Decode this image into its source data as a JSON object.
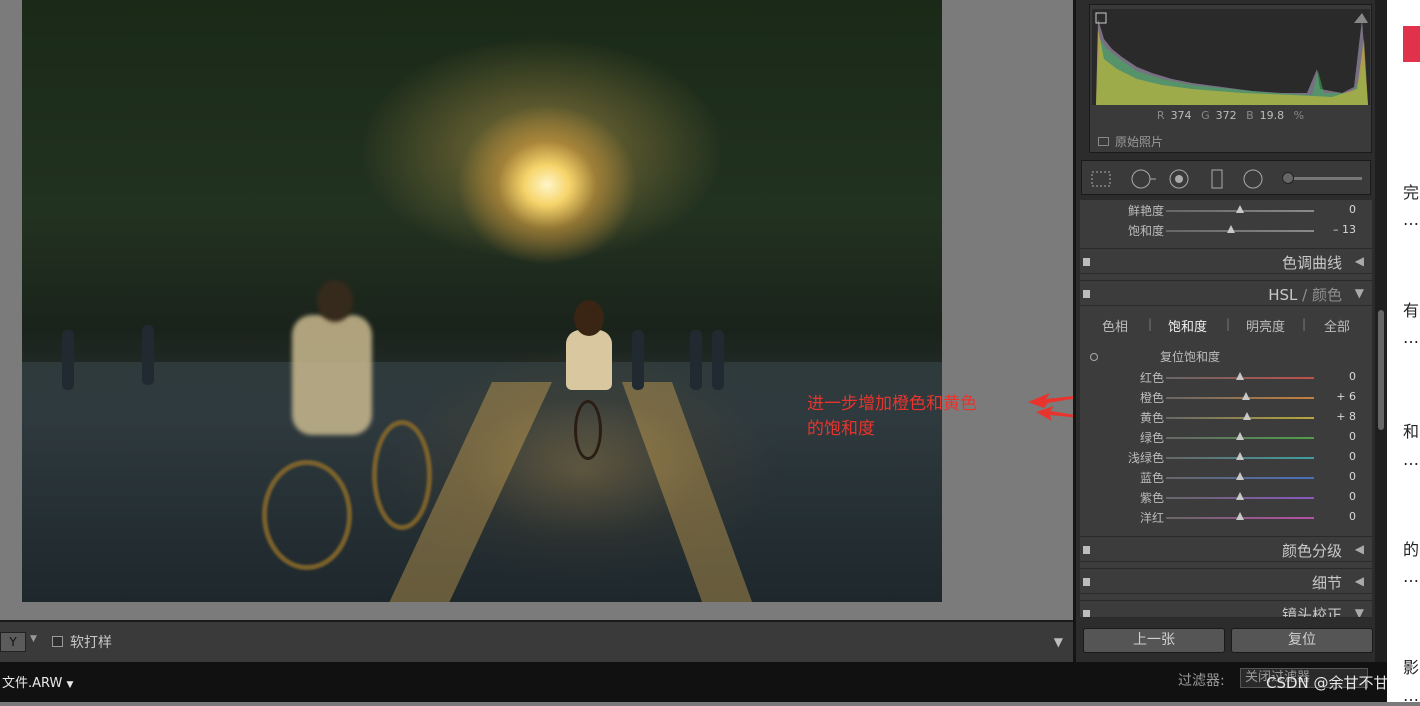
{
  "photo": {
    "annotation_lines": [
      "进一步增加橙色和黄色",
      "的饱和度"
    ],
    "annotation_color": "#e8342c"
  },
  "bottom_toolbar": {
    "view_switch": "Y",
    "softproof_label": "软打样"
  },
  "filmstrip": {
    "filename": "文件.ARW",
    "filter_label": "过滤器:",
    "filter_value": "关闭过滤器",
    "watermark": "CSDN @余甘不甘"
  },
  "histogram": {
    "r_label": "R",
    "r_value": "374",
    "g_label": "G",
    "g_value": "372",
    "b_label": "B",
    "b_value": "19.8",
    "unit": "%",
    "original_photo_label": "原始照片"
  },
  "presence_sliders": [
    {
      "label": "鲜艳度",
      "value": "0",
      "level": 0.5,
      "color": "#8a8a8a"
    },
    {
      "label": "饱和度",
      "value": "– 13",
      "level": 0.44,
      "color": "#8a8a8a"
    }
  ],
  "sections": {
    "tone_curve": "色调曲线",
    "hsl_title": "HSL",
    "hsl_sep": " / ",
    "hsl_color": "颜色",
    "split_toning": "颜色分级",
    "detail": "细节",
    "lens": "镜头校正"
  },
  "hsl_tabs": [
    "色相",
    "饱和度",
    "明亮度",
    "全部"
  ],
  "hsl_active_tab": "饱和度",
  "hsl_reset_label": "复位饱和度",
  "hsl_sliders": [
    {
      "label": "红色",
      "value": "0",
      "level": 0.5,
      "color": "#c0504a"
    },
    {
      "label": "橙色",
      "value": "+ 6",
      "level": 0.54,
      "color": "#c4803c"
    },
    {
      "label": "黄色",
      "value": "+ 8",
      "level": 0.55,
      "color": "#b8a83a"
    },
    {
      "label": "绿色",
      "value": "0",
      "level": 0.5,
      "color": "#4f9e4a"
    },
    {
      "label": "浅绿色",
      "value": "0",
      "level": 0.5,
      "color": "#3f9ea0"
    },
    {
      "label": "蓝色",
      "value": "0",
      "level": 0.5,
      "color": "#4a6fbe"
    },
    {
      "label": "紫色",
      "value": "0",
      "level": 0.5,
      "color": "#8a58c0"
    },
    {
      "label": "洋红",
      "value": "0",
      "level": 0.5,
      "color": "#b84fa6"
    }
  ],
  "buttons": {
    "previous": "上一张",
    "reset": "复位"
  },
  "blog_sidebar": [
    "完",
    "…",
    "有",
    "…",
    "和",
    "…",
    "的",
    "…",
    "影",
    "…"
  ]
}
